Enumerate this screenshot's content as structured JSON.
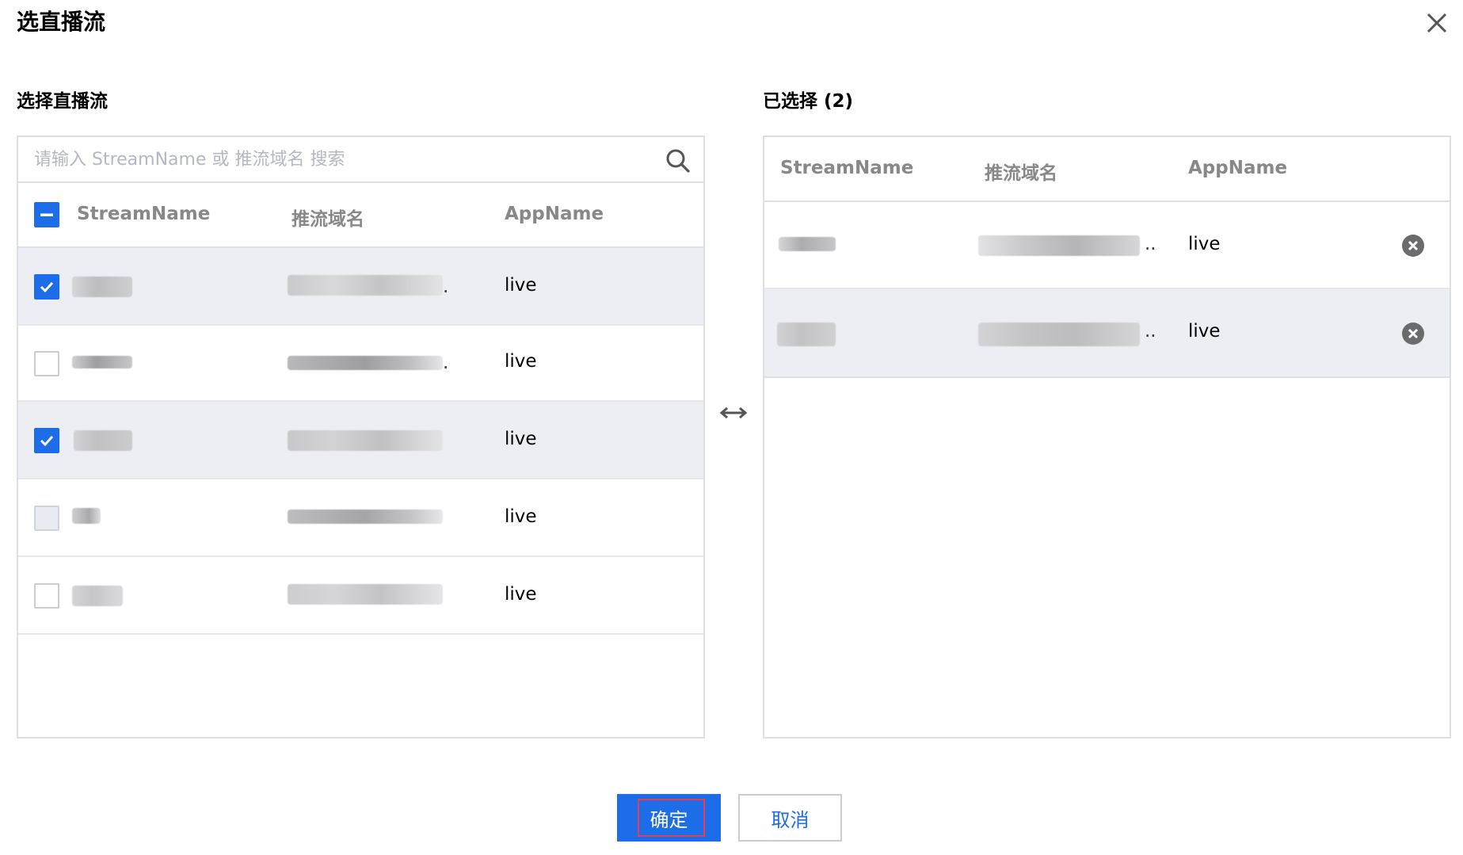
{
  "dialog": {
    "title": "选直播流",
    "close_icon": "close-icon"
  },
  "left": {
    "title": "选择直播流",
    "search": {
      "placeholder": "请输入 StreamName 或 推流域名 搜索",
      "icon": "search-icon"
    },
    "columns": [
      "StreamName",
      "推流域名",
      "AppName"
    ],
    "header_checkbox": "indeterminate",
    "rows": [
      {
        "app": "live",
        "checked": true,
        "disabled": false,
        "domain_suffix": "."
      },
      {
        "app": "live",
        "checked": false,
        "disabled": false,
        "domain_suffix": "."
      },
      {
        "app": "live",
        "checked": true,
        "disabled": false,
        "domain_suffix": ""
      },
      {
        "app": "live",
        "checked": false,
        "disabled": true,
        "domain_suffix": ""
      },
      {
        "app": "live",
        "checked": false,
        "disabled": false,
        "domain_suffix": ""
      }
    ]
  },
  "right": {
    "title": "已选择 (2)",
    "columns": [
      "StreamName",
      "推流域名",
      "AppName"
    ],
    "rows": [
      {
        "app": "live",
        "domain_suffix": "..",
        "remove_icon": "remove-icon"
      },
      {
        "app": "live",
        "domain_suffix": "..",
        "remove_icon": "remove-icon"
      }
    ]
  },
  "swap_icon": "swap-arrows-icon",
  "footer": {
    "ok_label": "确定",
    "cancel_label": "取消"
  },
  "colors": {
    "primary": "#1e6de8",
    "selected_row": "#eceef4",
    "border": "#dcdfe6",
    "focus_ring": "#e53c59"
  }
}
